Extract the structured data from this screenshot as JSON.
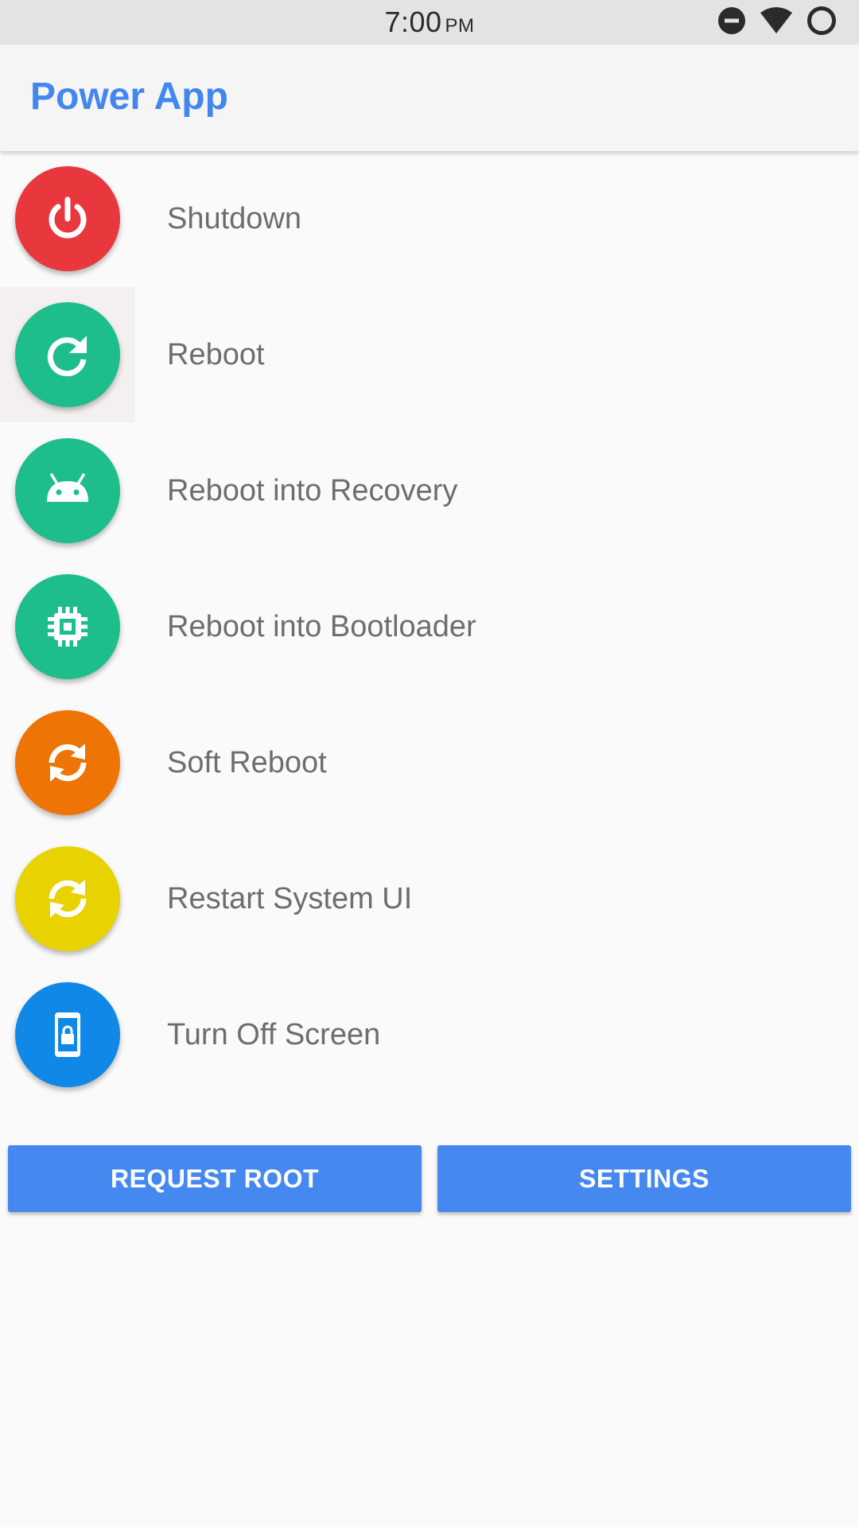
{
  "status_bar": {
    "time": "7:00",
    "ampm": "PM",
    "icons": [
      "do-not-disturb-icon",
      "wifi-icon",
      "battery-ring-icon"
    ]
  },
  "app_bar": {
    "title": "Power App",
    "title_color": "#4286f0"
  },
  "actions": [
    {
      "label": "Shutdown",
      "icon": "power-icon",
      "color": "#e8383e"
    },
    {
      "label": "Reboot",
      "icon": "reboot-icon",
      "color": "#1dbd8c"
    },
    {
      "label": "Reboot into Recovery",
      "icon": "android-icon",
      "color": "#1dbd8c"
    },
    {
      "label": "Reboot into Bootloader",
      "icon": "chip-icon",
      "color": "#1dbd8c"
    },
    {
      "label": "Soft Reboot",
      "icon": "sync-icon",
      "color": "#ee7406"
    },
    {
      "label": "Restart System UI",
      "icon": "sync-icon",
      "color": "#e8d200"
    },
    {
      "label": "Turn Off Screen",
      "icon": "phone-lock-icon",
      "color": "#1088e8"
    }
  ],
  "buttons": {
    "request_root": "REQUEST ROOT",
    "settings": "SETTINGS",
    "color": "#4588f0"
  }
}
